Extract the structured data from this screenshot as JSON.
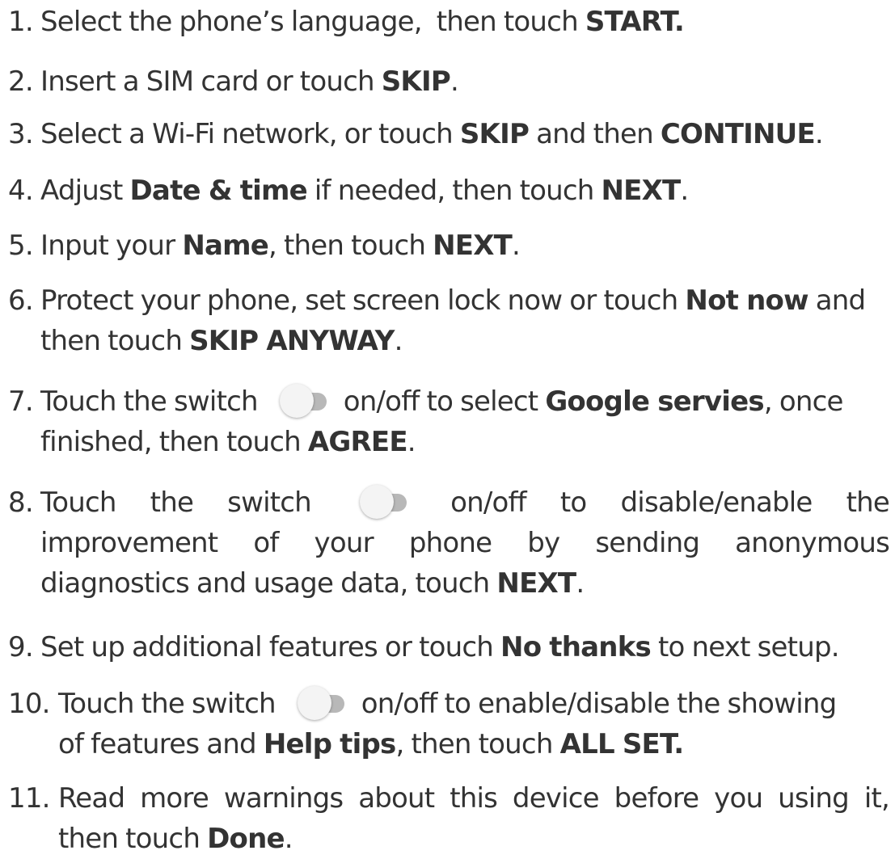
{
  "steps": [
    {
      "number": "1.",
      "text": {
        "t1": "Select the phone’s language,  then touch ",
        "b1": "START."
      }
    },
    {
      "number": "2.",
      "text": {
        "t1": "Insert a SIM card or touch ",
        "b1": "SKIP",
        "t2": "."
      }
    },
    {
      "number": "3.",
      "text": {
        "t1": "Select a Wi-Fi network, or touch ",
        "b1": "SKIP",
        "t2": " and then ",
        "b2": "CONTINUE",
        "t3": "."
      }
    },
    {
      "number": "4.",
      "text": {
        "t1": "Adjust ",
        "b1": "Date & time",
        "t2": " if needed, then touch ",
        "b2": "NEXT",
        "t3": "."
      }
    },
    {
      "number": "5.",
      "text": {
        "t1": "Input your ",
        "b1": "Name",
        "t2": ", then touch ",
        "b2": "NEXT",
        "t3": "."
      }
    },
    {
      "number": "6.",
      "text": {
        "t1": "Protect your phone, set screen lock now or touch ",
        "b1": "Not now",
        "t2": " and",
        "t3": "then touch ",
        "b2": "SKIP ANYWAY",
        "t4": "."
      }
    },
    {
      "number": "7.",
      "text": {
        "t1": "Touch the switch",
        "t2": "on/off to select ",
        "b1": "Google servies",
        "t3": ", once",
        "t4": "finished, then touch ",
        "b2": "AGREE",
        "t5": "."
      }
    },
    {
      "number": "8.",
      "text": {
        "w1": "Touch",
        "w2": "the",
        "w3": "switch",
        "w4": "on/off",
        "w5": "to",
        "w6": "disable/enable",
        "w7": "the",
        "l2": [
          "improvement",
          "of",
          "your",
          "phone",
          "by",
          "sending",
          "anonymous"
        ],
        "t1": "diagnostics and usage data, touch ",
        "b1": "NEXT",
        "t2": "."
      }
    },
    {
      "number": "9.",
      "text": {
        "t1": "Set up additional features or touch ",
        "b1": "No thanks",
        "t2": " to next setup."
      }
    },
    {
      "number": "10.",
      "text": {
        "t1": "Touch the switch",
        "t2": "on/off to enable/disable the showing",
        "t3": "of features and ",
        "b1": "Help tips",
        "t4": ", then touch ",
        "b2": "ALL SET."
      }
    },
    {
      "number": "11.",
      "text": {
        "l1": [
          "Read",
          "more",
          "warnings",
          "about",
          "this",
          "device",
          "before",
          "you",
          "using",
          "it,"
        ],
        "t1": "then touch ",
        "b1": "Done",
        "t2": "."
      }
    }
  ],
  "icons": {
    "switch": "toggle-switch-off-icon"
  },
  "colors": {
    "text": "#333333",
    "switch_track": "#b8b8b8",
    "switch_knob": "#f4f4f4"
  }
}
